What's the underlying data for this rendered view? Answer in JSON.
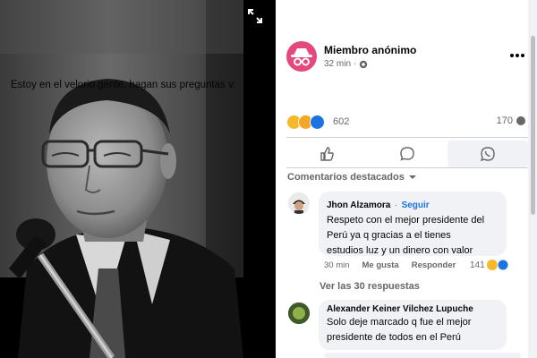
{
  "post": {
    "author": "Miembro anónimo",
    "time": "32 min",
    "dot": "·",
    "text": "Estoy en el velorio gente, hagan sus preguntas v:",
    "reaction_count": "602",
    "share_count": "170"
  },
  "comments_filter": {
    "label": "Comentarios destacados"
  },
  "comments": [
    {
      "author": "Jhon Alzamora",
      "separator": "·",
      "follow": "Seguir",
      "text_lines": [
        "Respeto con el mejor presidente del",
        "Perú ya q gracias a el tienes",
        "estudios luz y un dinero con valor"
      ],
      "time": "30 min",
      "like": "Me gusta",
      "reply": "Responder",
      "reactions": "141"
    },
    {
      "author": "Alexander Keiner Vilchez Lupuche",
      "text_lines": [
        "Solo deje marcado q fue el mejor",
        "presidente de todos en el Perú"
      ]
    }
  ],
  "replies_link": "Ver las 30 respuestas",
  "icons": {
    "expand": "expand-icon",
    "globe": "globe-icon",
    "more": "more-options-icon",
    "like": "like-icon",
    "comment": "comment-icon",
    "whatsapp": "whatsapp-icon",
    "share": "share-icon",
    "dropdown": "chevron-down-icon"
  },
  "colors": {
    "anon_avatar": "#e4487c",
    "link": "#1b74e4",
    "bubble": "#f0f2f5",
    "muted_text": "#65676b",
    "photo_background": "#000000"
  }
}
